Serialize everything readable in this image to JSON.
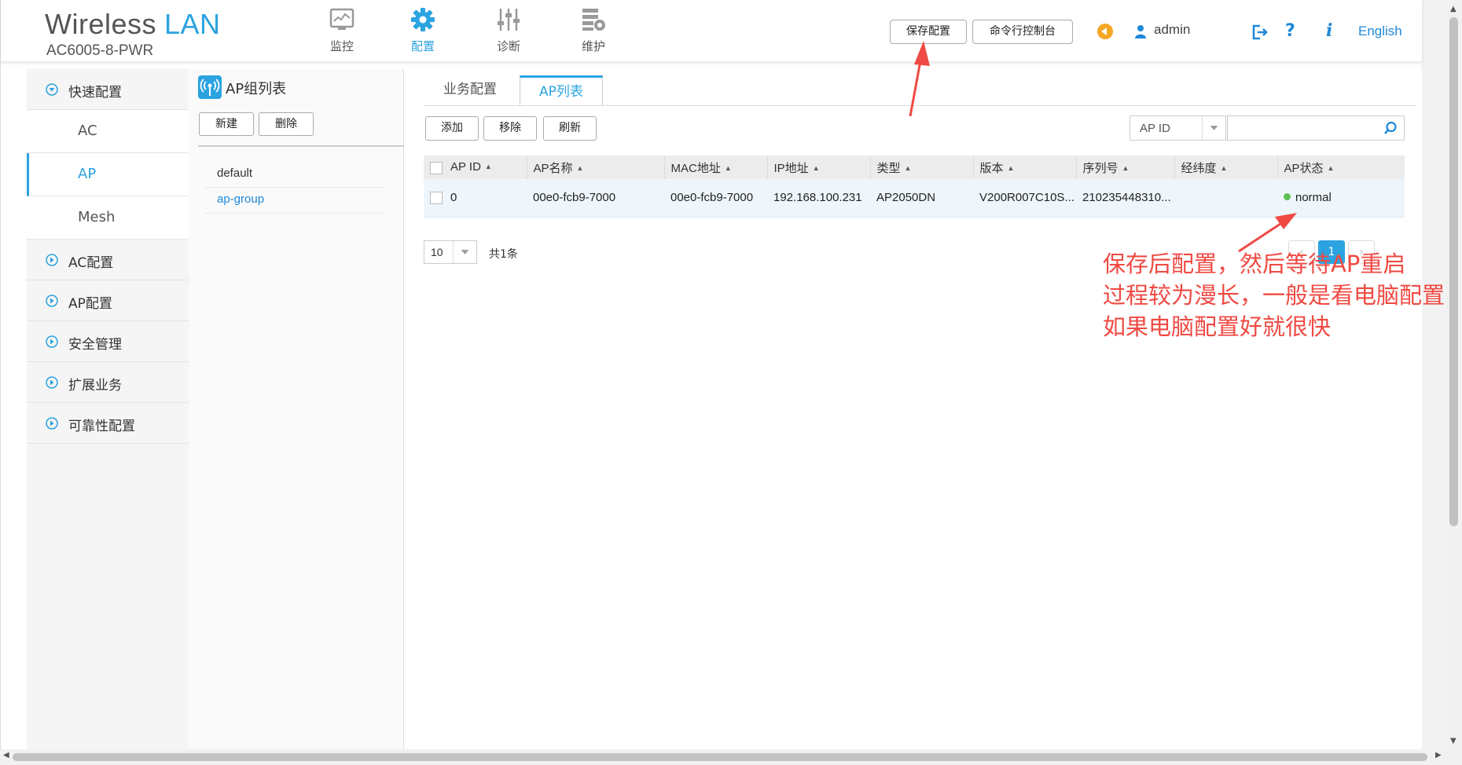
{
  "header": {
    "title_part1": "Wireless",
    "title_part2": "LAN",
    "model": "AC6005-8-PWR",
    "nav": [
      {
        "label": "监控",
        "icon": "monitor-icon"
      },
      {
        "label": "配置",
        "icon": "gear-icon"
      },
      {
        "label": "诊断",
        "icon": "sliders-icon"
      },
      {
        "label": "维护",
        "icon": "maintenance-icon"
      }
    ],
    "save_config": "保存配置",
    "cli_console": "命令行控制台",
    "user": "admin",
    "language": "English",
    "help": "?",
    "info": "i"
  },
  "sidebar": {
    "quick_config": "快速配置",
    "sub_items": [
      "AC",
      "AP",
      "Mesh"
    ],
    "active_sub": "AP",
    "sections": [
      "AC配置",
      "AP配置",
      "安全管理",
      "扩展业务",
      "可靠性配置"
    ]
  },
  "group_panel": {
    "title": "AP组列表",
    "new_button": "新建",
    "delete_button": "删除",
    "groups": [
      "default",
      "ap-group"
    ],
    "selected": "ap-group"
  },
  "main": {
    "tabs": [
      "业务配置",
      "AP列表"
    ],
    "active_tab": "AP列表",
    "toolbar": {
      "add": "添加",
      "remove": "移除",
      "refresh": "刷新"
    },
    "search": {
      "field": "AP ID",
      "value": ""
    },
    "table": {
      "columns": [
        "AP ID",
        "AP名称",
        "MAC地址",
        "IP地址",
        "类型",
        "版本",
        "序列号",
        "经纬度",
        "AP状态"
      ],
      "rows": [
        {
          "ap_id": "0",
          "ap_name": "00e0-fcb9-7000",
          "mac": "00e0-fcb9-7000",
          "ip": "192.168.100.231",
          "type": "AP2050DN",
          "version": "V200R007C10S...",
          "serial": "210235448310...",
          "coords": "",
          "status": "normal"
        }
      ]
    },
    "pagination": {
      "page_size": "10",
      "total": "共1条",
      "current_page": "1",
      "prev": "‹",
      "next": "›"
    }
  },
  "annotation": {
    "lines": [
      "保存后配置，然后等待AP重启",
      "过程较为漫长，一般是看电脑配置",
      "如果电脑配置好就很快"
    ]
  },
  "colors": {
    "accent": "#2ba3e0",
    "link": "#1e88d8",
    "status_ok": "#5cc251",
    "annotation": "#ef4a43",
    "warning": "#f5a623"
  }
}
